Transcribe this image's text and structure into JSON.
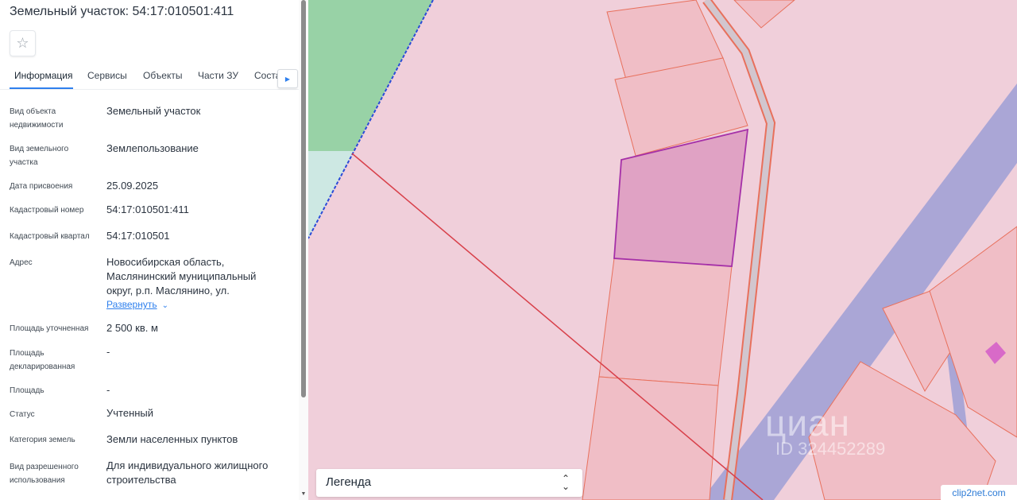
{
  "panel": {
    "title": "Земельный участок: 54:17:010501:411",
    "star_icon": "star-icon",
    "tabs": [
      {
        "label": "Информация"
      },
      {
        "label": "Сервисы"
      },
      {
        "label": "Объекты"
      },
      {
        "label": "Части ЗУ"
      },
      {
        "label": "Соста"
      }
    ],
    "tab_scroll_icon": "chevron-right-icon",
    "fields": [
      {
        "label": "Вид объекта недвижимости",
        "value": "Земельный участок"
      },
      {
        "label": "Вид земельного участка",
        "value": "Землепользование"
      },
      {
        "label": "Дата присвоения",
        "value": "25.09.2025"
      },
      {
        "label": "Кадастровый номер",
        "value": "54:17:010501:411"
      },
      {
        "label": "Кадастровый квартал",
        "value": "54:17:010501"
      },
      {
        "label": "Адрес",
        "value": "Новосибирская область, Маслянинский муниципальный округ, р.п. Маслянино, ул."
      },
      {
        "label": "Площадь уточненная",
        "value": "2 500 кв. м"
      },
      {
        "label": "Площадь декларированная",
        "value": "-"
      },
      {
        "label": "Площадь",
        "value": "-"
      },
      {
        "label": "Статус",
        "value": "Учтенный"
      },
      {
        "label": "Категория земель",
        "value": "Земли населенных пунктов"
      },
      {
        "label": "Вид разрешенного использования",
        "value": "Для индивидуального жилищного строительства"
      }
    ],
    "expand_link": "Развернуть"
  },
  "map": {
    "legend_label": "Легенда",
    "watermark": "циан",
    "watermark_id": "ID 324452289",
    "badge_text": "clip2net.com",
    "colors": {
      "background": "#f0cfda",
      "parcel_fill": "#f0bec6",
      "parcel_stroke": "#e8705c",
      "selected_fill": "#e0a2c4",
      "selected_stroke": "#a530a8",
      "road": "#aaa6d6",
      "green_zone": "#98d2a6"
    }
  }
}
